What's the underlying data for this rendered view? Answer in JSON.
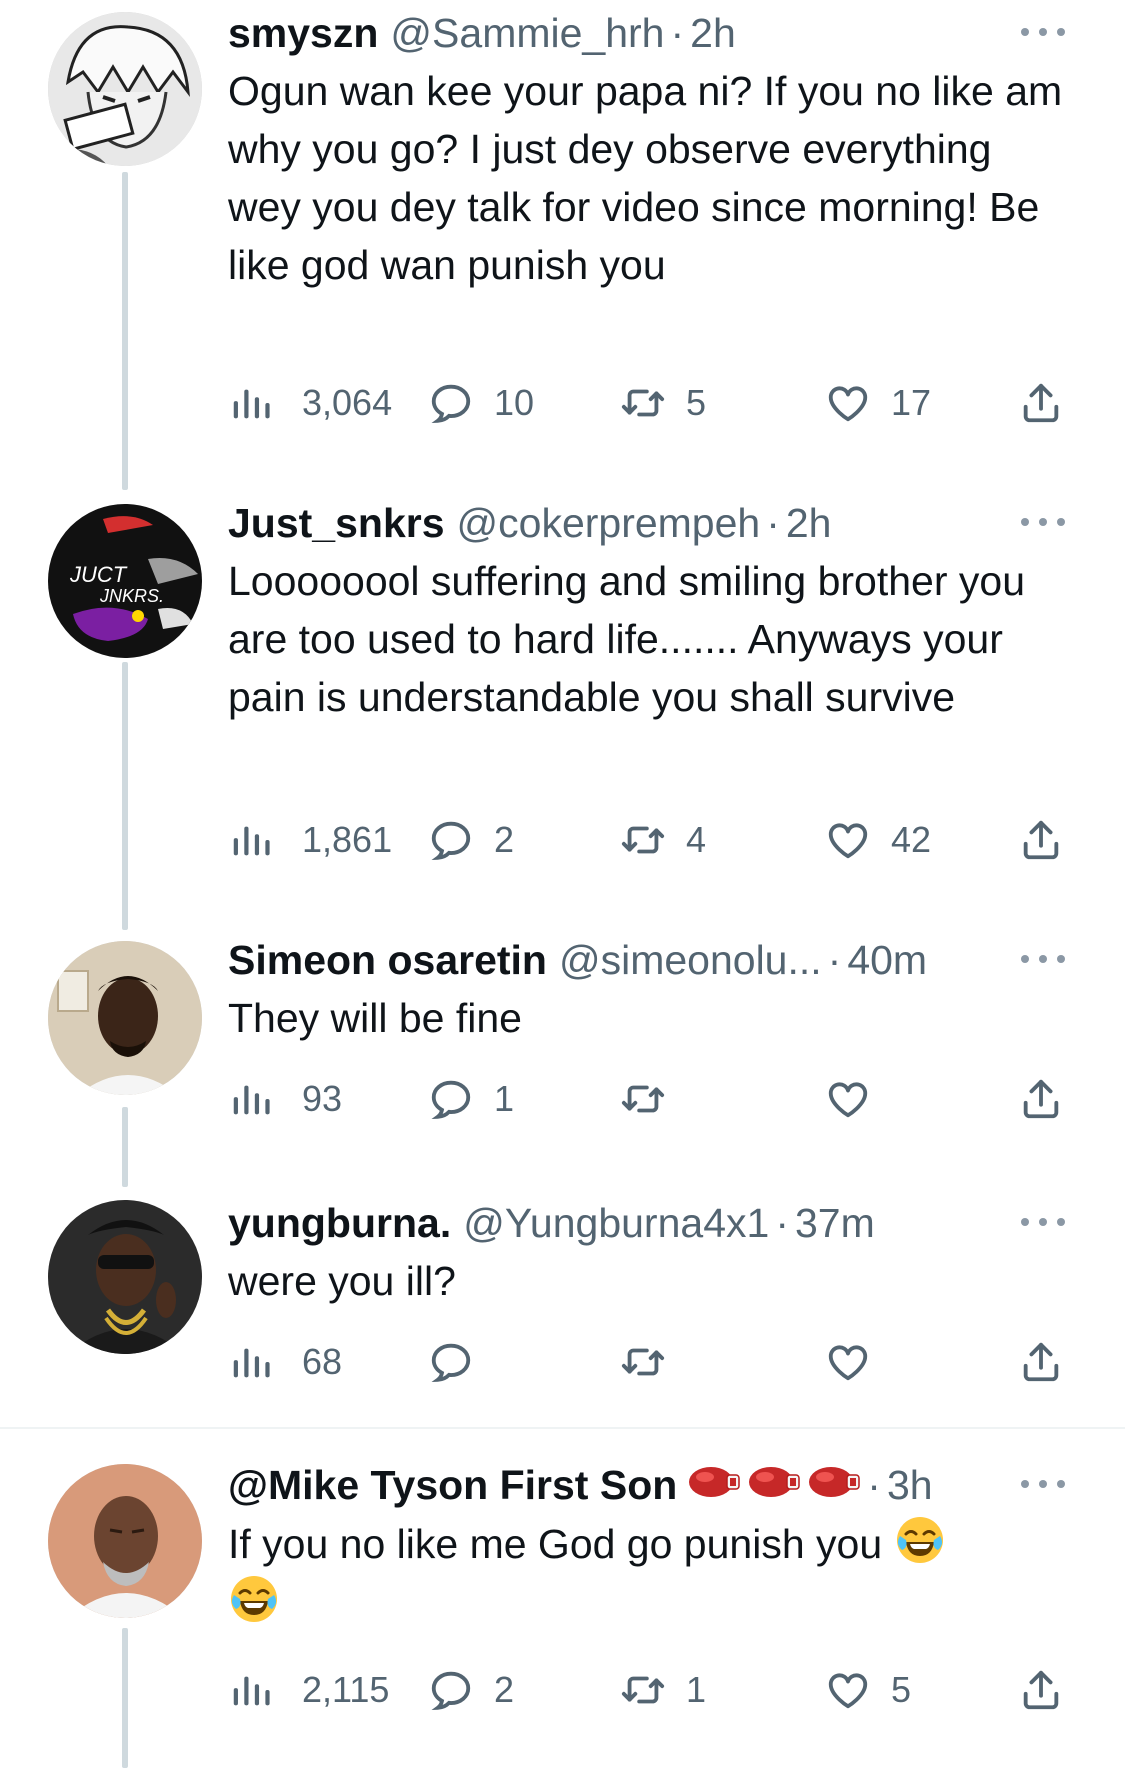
{
  "tweets": [
    {
      "name": "smyszn",
      "handle": "@Sammie_hrh",
      "separator": "·",
      "time": "2h",
      "text": "Ogun wan kee your papa ni? If you no like am why you go? I just dey observe everything wey you dey talk for video since morning! Be like god wan punish you",
      "views": "3,064",
      "replies": "10",
      "retweets": "5",
      "likes": "17"
    },
    {
      "name": "Just_snkrs",
      "handle": "@cokerprempeh",
      "separator": "·",
      "time": "2h",
      "text": "Loooooool suffering and smiling brother you are too used to hard life....... Anyways your pain is understandable you shall survive",
      "views": "1,861",
      "replies": "2",
      "retweets": "4",
      "likes": "42"
    },
    {
      "name": "Simeon osaretin",
      "handle": "@simeonolu...",
      "separator": "·",
      "time": "40m",
      "text": "They will  be fine",
      "views": "93",
      "replies": "1",
      "retweets": "",
      "likes": ""
    },
    {
      "name": "yungburna.",
      "handle": "@Yungburna4x1",
      "separator": "·",
      "time": "37m",
      "text": "were you ill?",
      "views": "68",
      "replies": "",
      "retweets": "",
      "likes": ""
    },
    {
      "name": "@Mike Tyson First Son",
      "handle": "",
      "separator": "·",
      "time": "3h",
      "text": "If you no like me God go punish you",
      "views": "2,115",
      "replies": "2",
      "retweets": "1",
      "likes": "5"
    }
  ],
  "icons": {
    "views": "bar-chart-icon",
    "reply": "speech-bubble-icon",
    "retweet": "retweet-arrows-icon",
    "like": "heart-icon",
    "share": "share-upload-icon",
    "more": "more-dots-icon"
  },
  "colors": {
    "text": "#0f1419",
    "secondary": "#536471",
    "thread_line": "#cfd9de"
  }
}
